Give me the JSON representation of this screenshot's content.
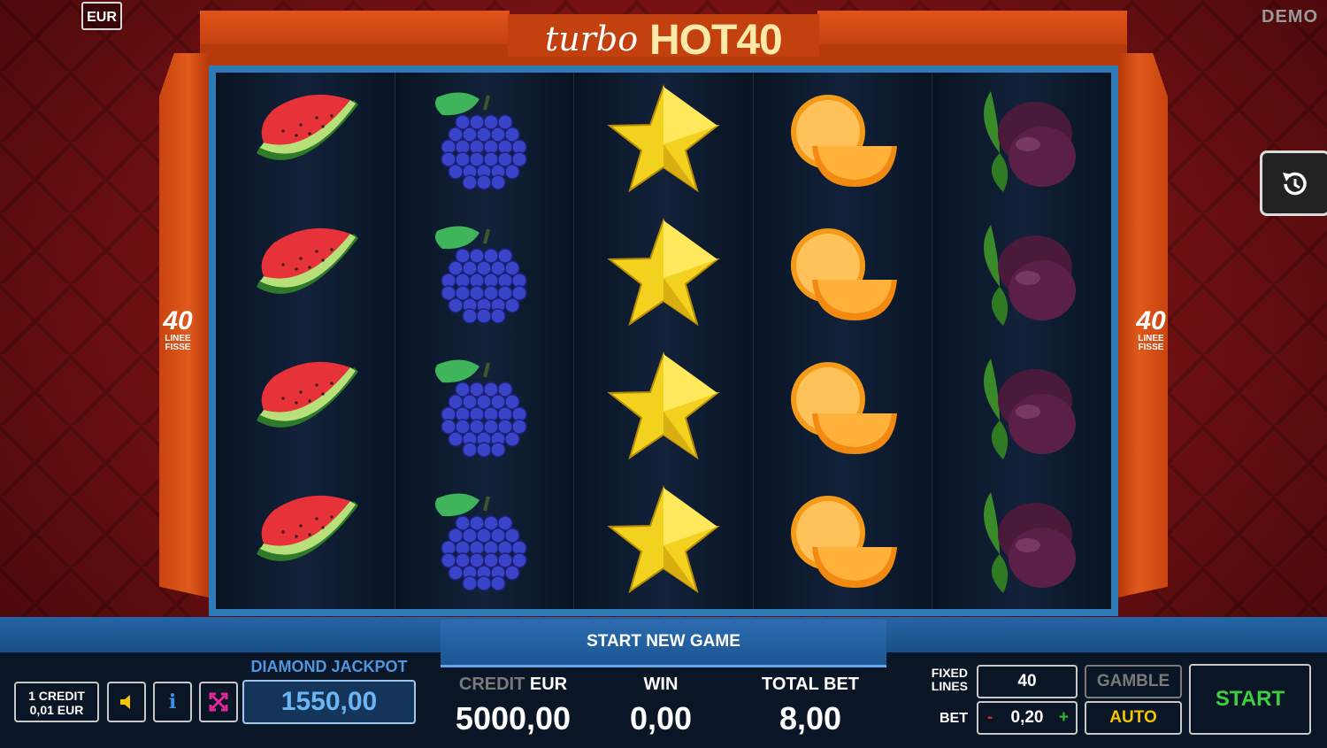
{
  "currency_tag": "EUR",
  "mode_tag": "DEMO",
  "logo": {
    "part1": "turbo",
    "part2": "HOT40"
  },
  "side_badge": {
    "number": "40",
    "line1": "LINEE",
    "line2": "FISSE"
  },
  "reels": [
    {
      "symbol": "watermelon-icon"
    },
    {
      "symbol": "grapes-icon"
    },
    {
      "symbol": "star-icon"
    },
    {
      "symbol": "orange-icon"
    },
    {
      "symbol": "plum-icon"
    }
  ],
  "start_new_game": "START NEW GAME",
  "credit_info": {
    "line1": "1 CREDIT",
    "line2": "0,01 EUR"
  },
  "jackpot": {
    "label": "DIAMOND JACKPOT",
    "value": "1550,00"
  },
  "credit": {
    "label_a": "CREDIT",
    "label_b": "EUR",
    "value": "5000,00"
  },
  "win": {
    "label": "WIN",
    "value": "0,00"
  },
  "total_bet": {
    "label": "TOTAL BET",
    "value": "8,00"
  },
  "fixed_lines": {
    "label1": "FIXED",
    "label2": "LINES",
    "value": "40"
  },
  "bet": {
    "label": "BET",
    "minus": "-",
    "value": "0,20",
    "plus": "+"
  },
  "buttons": {
    "gamble": "GAMBLE",
    "auto": "AUTO",
    "start": "START"
  },
  "colors": {
    "accent": "#2f7bb8",
    "frame": "#e05a1c",
    "start": "#3fce3f",
    "auto": "#f4c400"
  }
}
